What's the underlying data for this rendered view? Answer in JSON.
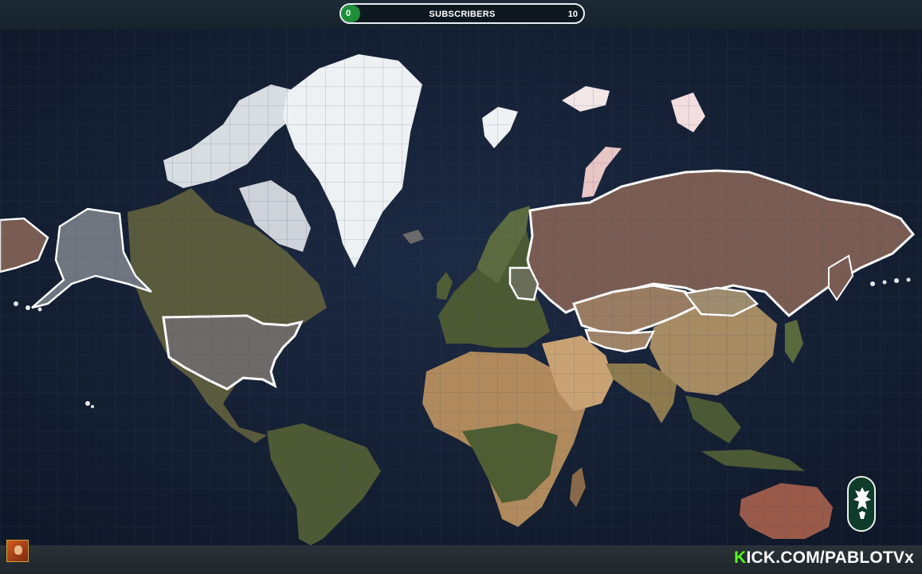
{
  "subscriber_bar": {
    "label": "SUBSCRIBERS",
    "min": "0",
    "max": "10",
    "progress": 0.08,
    "fill_color": "#1f8f3a"
  },
  "map": {
    "highlighted_regions": [
      "Russia",
      "Belarus",
      "Kazakhstan",
      "Central Asia",
      "United States",
      "Alaska",
      "Mongolia",
      "Svalbard",
      "Franz Josef Land",
      "Novaya Zemlya",
      "Sakhalin",
      "Kuril Islands",
      "Aleutian Islands",
      "Hawaii"
    ],
    "highlight_color": "#ffffff"
  },
  "branding": {
    "k_letter": "K",
    "rest": "ICK.COM/PABLOTVx",
    "k_color": "#53fc18"
  },
  "emblem": {
    "icon": "eagle-emblem-icon"
  },
  "avatar": {
    "icon": "streamer-avatar"
  }
}
